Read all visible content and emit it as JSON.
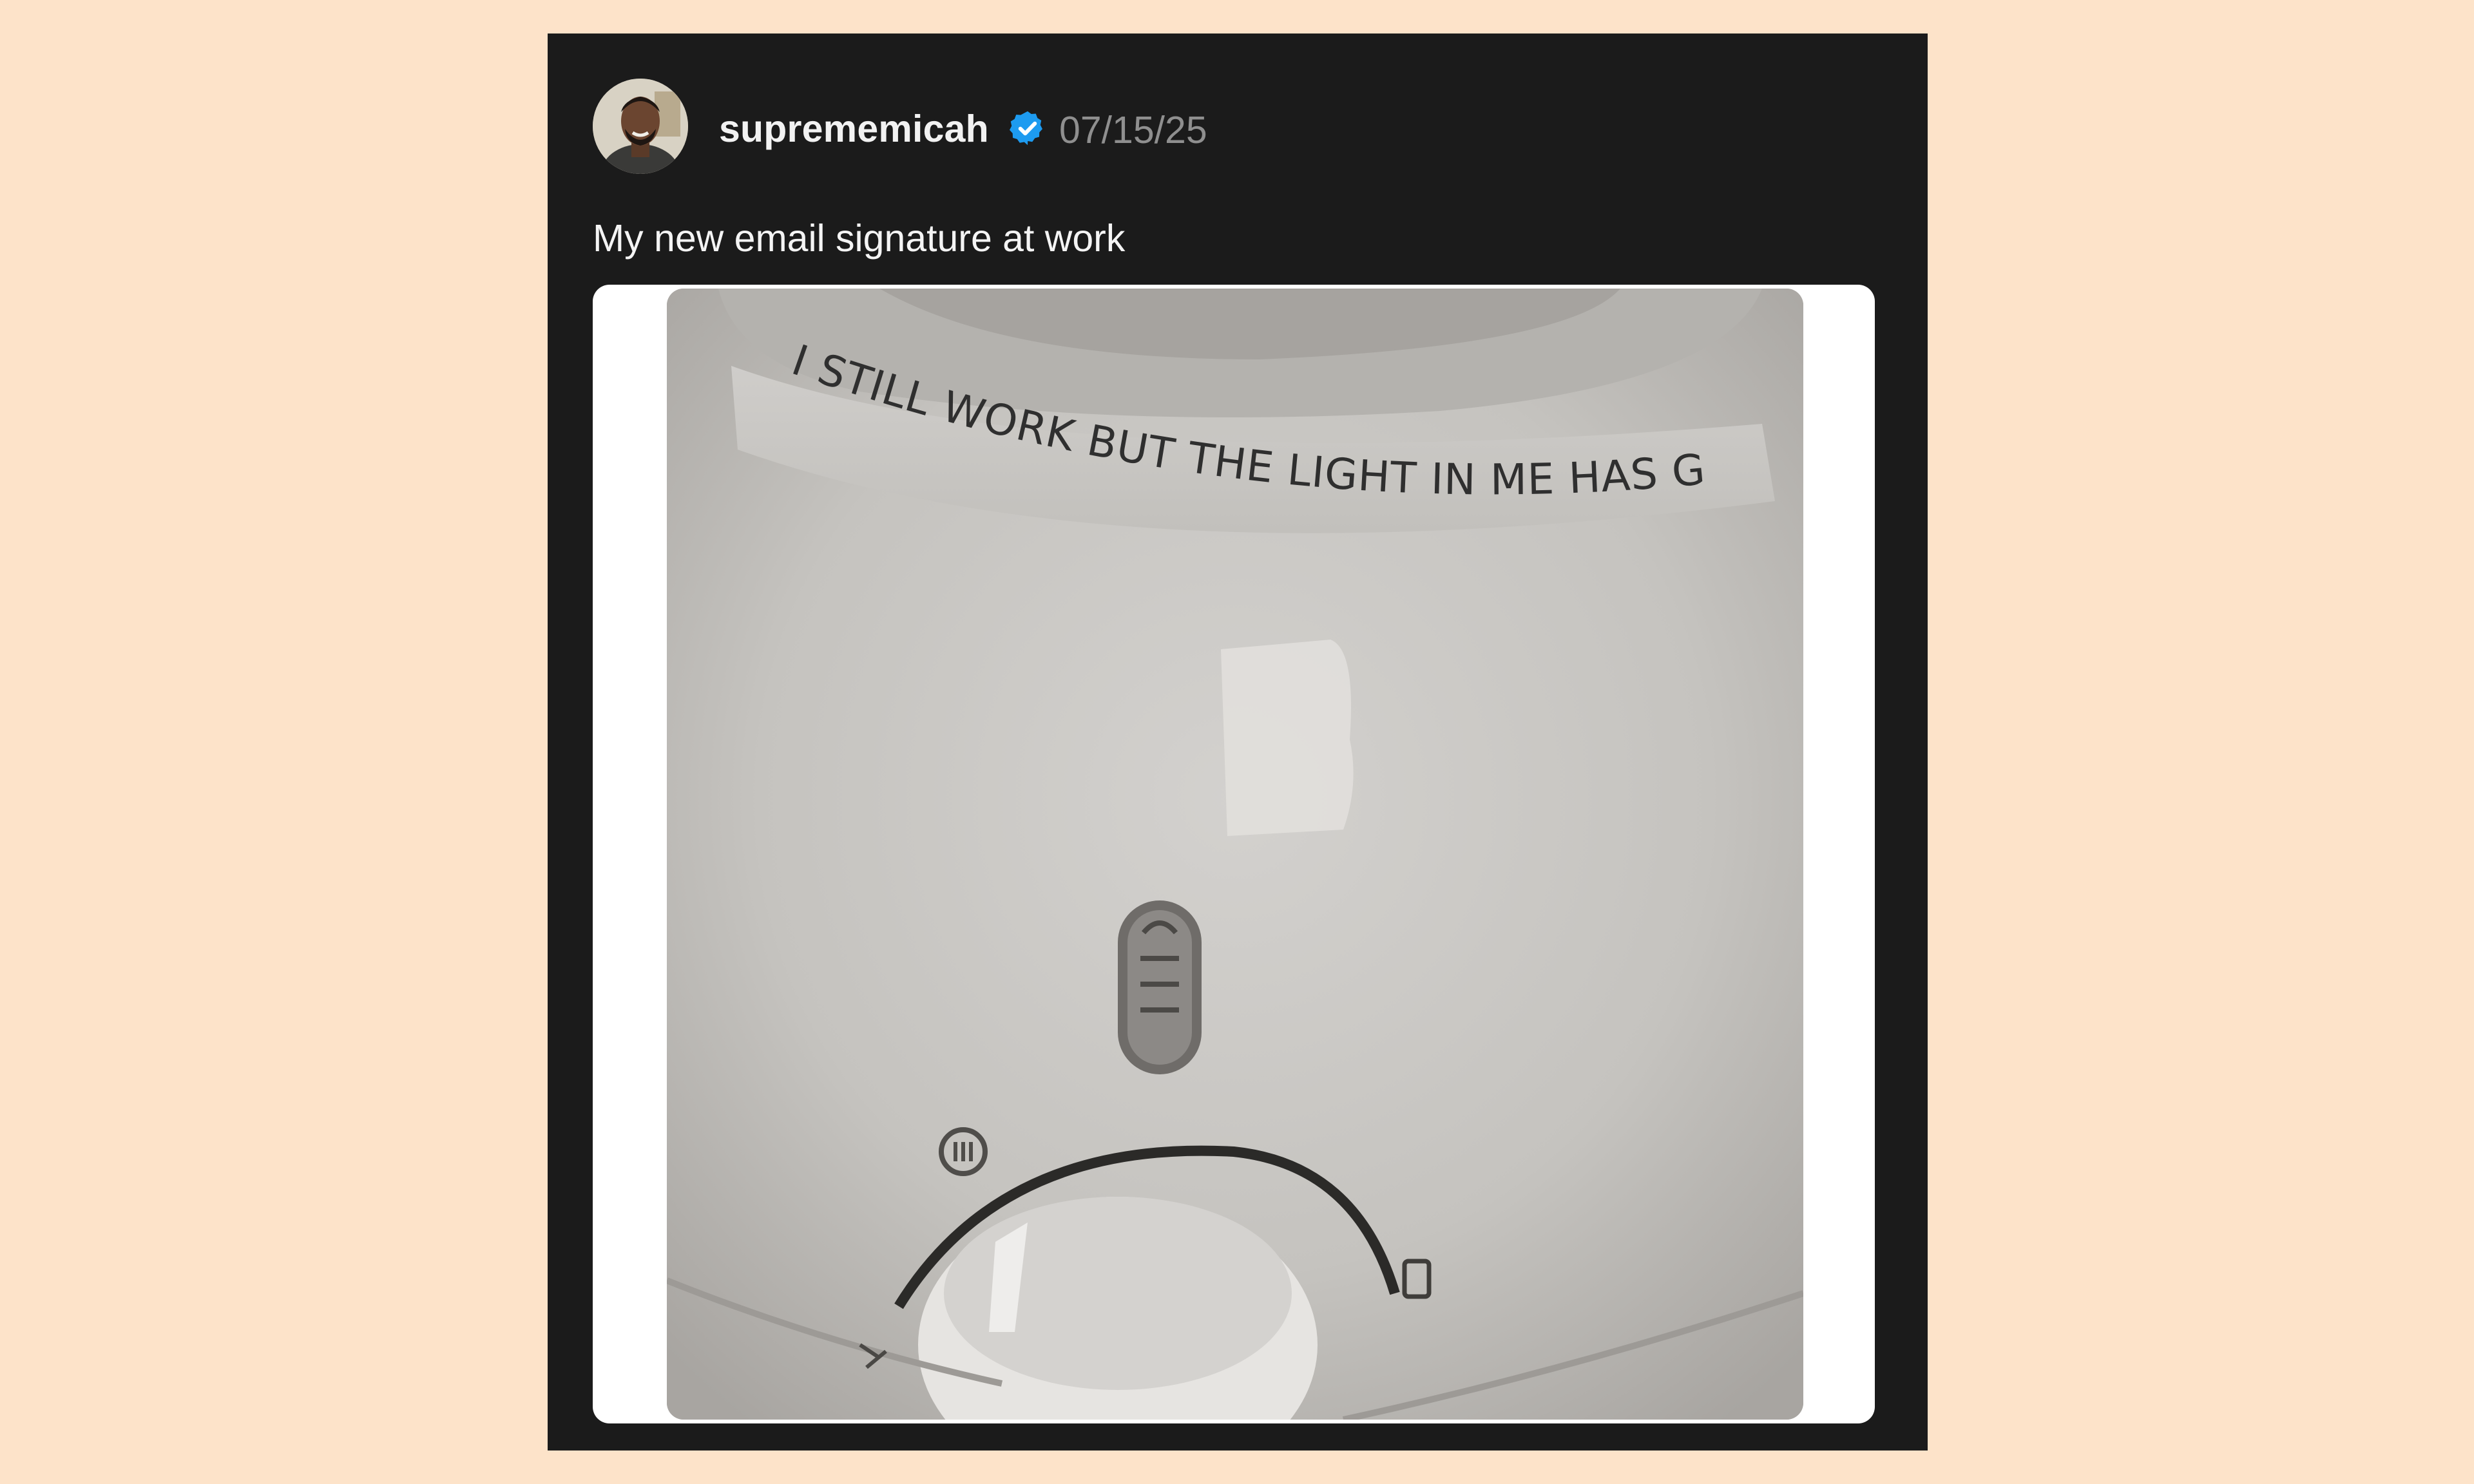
{
  "post": {
    "author": {
      "username": "suprememicah",
      "verified": true,
      "avatar_icon": "person-avatar-icon"
    },
    "date": "07/15/25",
    "text": "My new email signature at work",
    "media": {
      "printed_text": "I STILL WORK BUT THE LIGHT IN ME HAS GONE"
    }
  },
  "colors": {
    "page_background": "#fde3c9",
    "card_background": "#1b1b1b",
    "verified_blue": "#1d9bf0",
    "date_gray": "#8f8f8f",
    "text_white": "#f4f4f4"
  }
}
